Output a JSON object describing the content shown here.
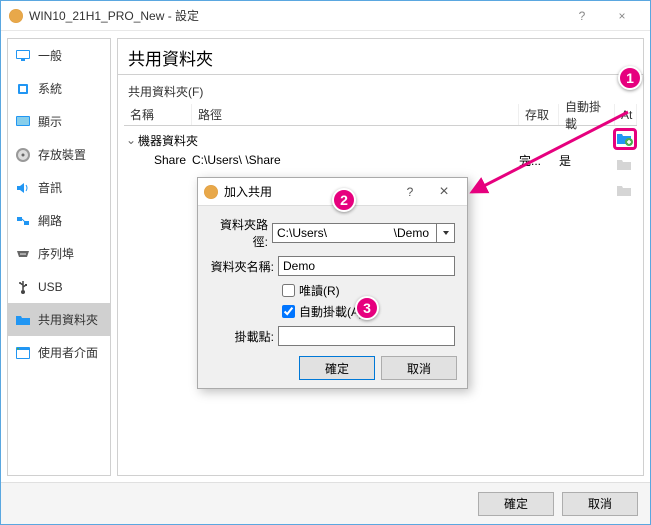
{
  "window": {
    "title": "WIN10_21H1_PRO_New - 設定",
    "help": "?",
    "close": "×"
  },
  "sidebar": {
    "items": [
      {
        "label": "一般"
      },
      {
        "label": "系統"
      },
      {
        "label": "顯示"
      },
      {
        "label": "存放裝置"
      },
      {
        "label": "音訊"
      },
      {
        "label": "網路"
      },
      {
        "label": "序列埠"
      },
      {
        "label": "USB"
      },
      {
        "label": "共用資料夾"
      },
      {
        "label": "使用者介面"
      }
    ]
  },
  "main": {
    "header": "共用資料夾",
    "sub_label": "共用資料夾(F)",
    "columns": {
      "name": "名稱",
      "path": "路徑",
      "access": "存取",
      "automount": "自動掛載",
      "at": "At"
    },
    "tree_root": "機器資料夾",
    "row": {
      "name": "Share",
      "path": "C:\\Users\\                              \\Share",
      "access": "完...",
      "automount": "是"
    }
  },
  "dialog": {
    "title": "加入共用",
    "help": "?",
    "close": "×",
    "fields": {
      "path_label": "資料夾路徑:",
      "path_value": "C:\\Users\\                    \\Demo",
      "name_label": "資料夾名稱:",
      "name_value": "Demo",
      "readonly_label": "唯讀(R)",
      "automount_label": "自動掛載(A)",
      "mountpoint_label": "掛載點:",
      "mountpoint_value": ""
    },
    "readonly_checked": false,
    "automount_checked": true,
    "ok": "確定",
    "cancel": "取消"
  },
  "footer": {
    "ok": "確定",
    "cancel": "取消"
  },
  "annotations": {
    "a1": "1",
    "a2": "2",
    "a3": "3"
  }
}
